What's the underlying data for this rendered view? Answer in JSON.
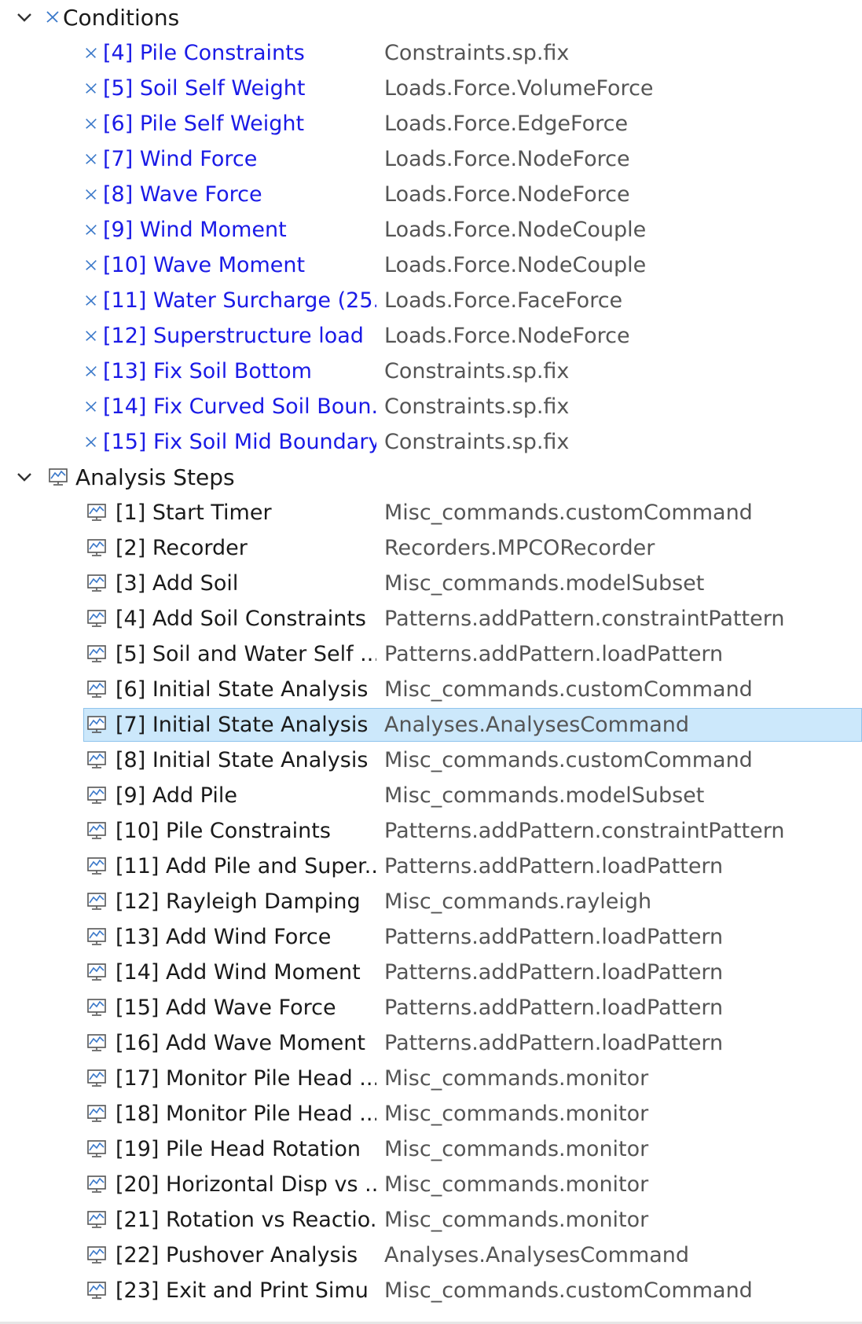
{
  "colors": {
    "condition_text": "#1a1ae6",
    "step_text": "#1a1a1a",
    "type_text": "#555555",
    "selection_bg": "#cce8fb",
    "selection_border": "#8fc4ec"
  },
  "conditions": {
    "label": "Conditions",
    "icon": "condition-icon",
    "items": [
      {
        "name": "[4] Pile Constraints",
        "type": "Constraints.sp.fix"
      },
      {
        "name": "[5] Soil Self Weight",
        "type": "Loads.Force.VolumeForce"
      },
      {
        "name": "[6] Pile Self Weight",
        "type": "Loads.Force.EdgeForce"
      },
      {
        "name": "[7] Wind Force",
        "type": "Loads.Force.NodeForce"
      },
      {
        "name": "[8] Wave Force",
        "type": "Loads.Force.NodeForce"
      },
      {
        "name": "[9] Wind Moment",
        "type": "Loads.Force.NodeCouple"
      },
      {
        "name": "[10] Wave Moment",
        "type": "Loads.Force.NodeCouple"
      },
      {
        "name": "[11] Water Surcharge (25...",
        "type": "Loads.Force.FaceForce"
      },
      {
        "name": "[12] Superstructure load",
        "type": "Loads.Force.NodeForce"
      },
      {
        "name": "[13] Fix Soil Bottom",
        "type": "Constraints.sp.fix"
      },
      {
        "name": "[14] Fix Curved Soil Boun...",
        "type": "Constraints.sp.fix"
      },
      {
        "name": "[15] Fix Soil Mid Boundary",
        "type": "Constraints.sp.fix"
      }
    ]
  },
  "analysis_steps": {
    "label": "Analysis Steps",
    "icon": "chart-icon",
    "selected_index": 6,
    "items": [
      {
        "name": "[1] Start Timer",
        "type": "Misc_commands.customCommand"
      },
      {
        "name": "[2] Recorder",
        "type": "Recorders.MPCORecorder"
      },
      {
        "name": "[3] Add Soil",
        "type": "Misc_commands.modelSubset"
      },
      {
        "name": "[4] Add Soil Constraints",
        "type": "Patterns.addPattern.constraintPattern"
      },
      {
        "name": "[5] Soil and Water Self ...",
        "type": "Patterns.addPattern.loadPattern"
      },
      {
        "name": "[6] Initial State Analysis ...",
        "type": "Misc_commands.customCommand"
      },
      {
        "name": "[7] Initial State Analysis",
        "type": "Analyses.AnalysesCommand"
      },
      {
        "name": "[8] Initial State Analysis ...",
        "type": "Misc_commands.customCommand"
      },
      {
        "name": "[9] Add Pile",
        "type": "Misc_commands.modelSubset"
      },
      {
        "name": "[10] Pile Constraints",
        "type": "Patterns.addPattern.constraintPattern"
      },
      {
        "name": "[11] Add Pile and Super...",
        "type": "Patterns.addPattern.loadPattern"
      },
      {
        "name": "[12] Rayleigh Damping",
        "type": "Misc_commands.rayleigh"
      },
      {
        "name": "[13] Add Wind Force",
        "type": "Patterns.addPattern.loadPattern"
      },
      {
        "name": "[14] Add Wind Moment",
        "type": "Patterns.addPattern.loadPattern"
      },
      {
        "name": "[15] Add Wave Force",
        "type": "Patterns.addPattern.loadPattern"
      },
      {
        "name": "[16] Add Wave Moment",
        "type": "Patterns.addPattern.loadPattern"
      },
      {
        "name": "[17] Monitor Pile Head ...",
        "type": "Misc_commands.monitor"
      },
      {
        "name": "[18] Monitor Pile Head ...",
        "type": "Misc_commands.monitor"
      },
      {
        "name": "[19] Pile Head Rotation",
        "type": "Misc_commands.monitor"
      },
      {
        "name": "[20] Horizontal Disp vs ...",
        "type": "Misc_commands.monitor"
      },
      {
        "name": "[21] Rotation vs Reactio...",
        "type": "Misc_commands.monitor"
      },
      {
        "name": "[22] Pushover Analysis",
        "type": "Analyses.AnalysesCommand"
      },
      {
        "name": "[23] Exit and Print Simu ...",
        "type": "Misc_commands.customCommand"
      }
    ]
  }
}
